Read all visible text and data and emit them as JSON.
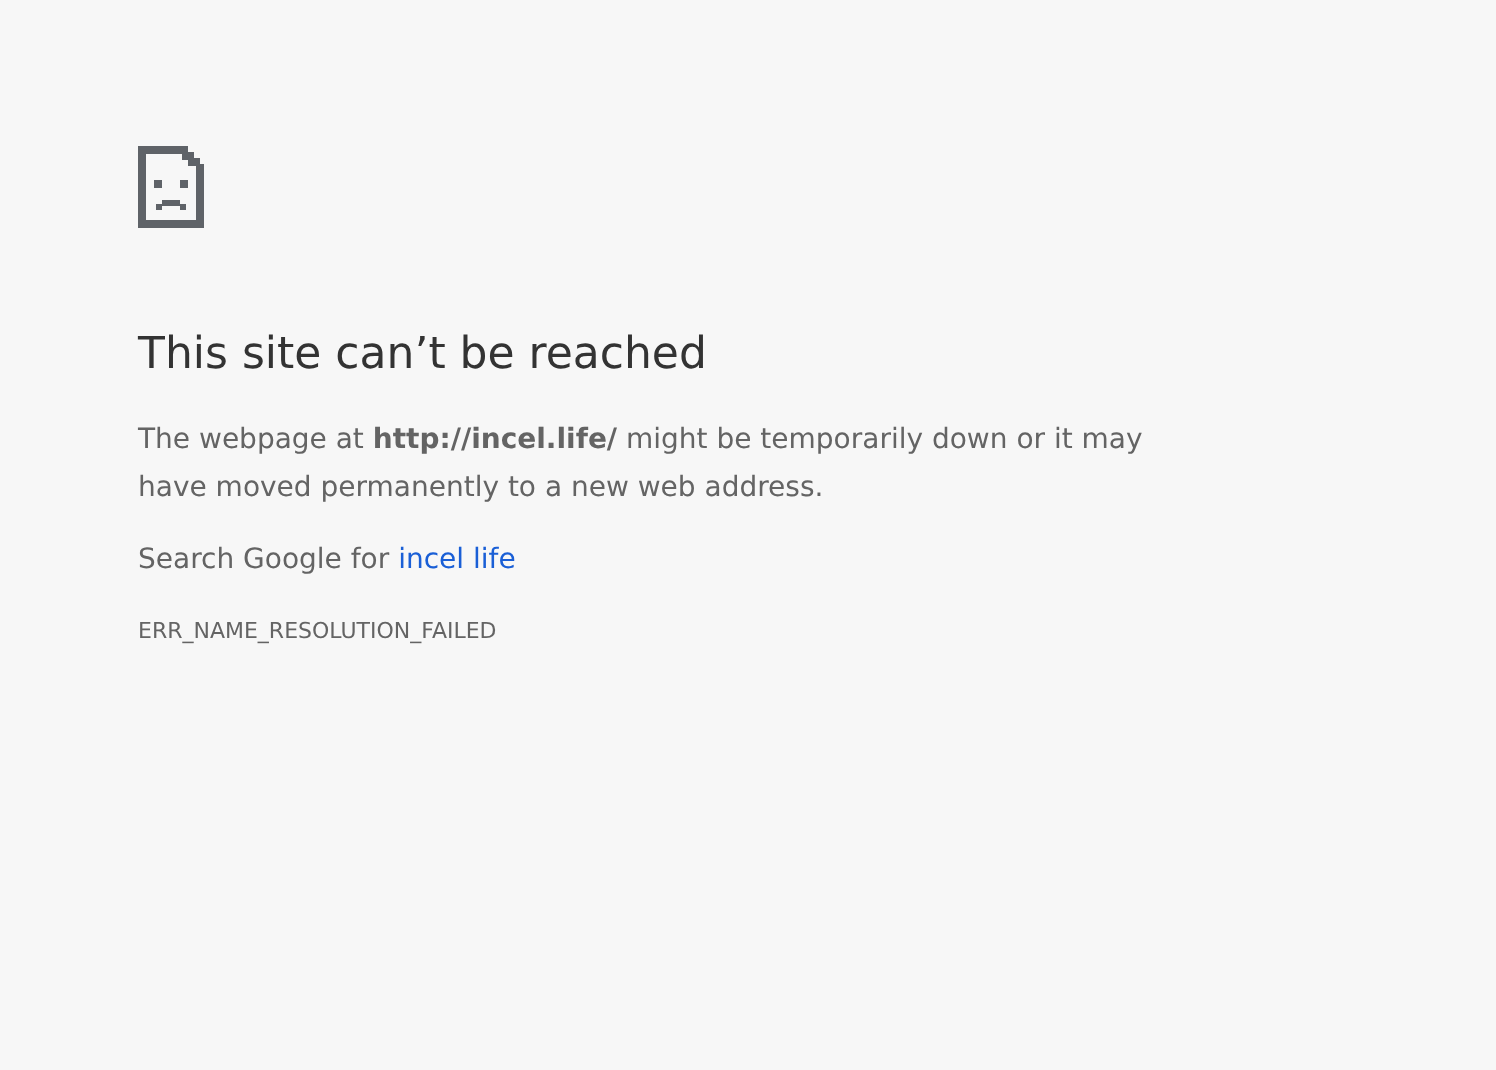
{
  "heading": "This site can’t be reached",
  "message": "The webpage at **http://incel.life/** might be temporarily down or it may have moved permanently to a new web address.",
  "suggestion": {
    "prefix": "Search Google for",
    "link": "incel life"
  },
  "error_code": "ERR_NAME_RESOLUTION_FAILED"
}
